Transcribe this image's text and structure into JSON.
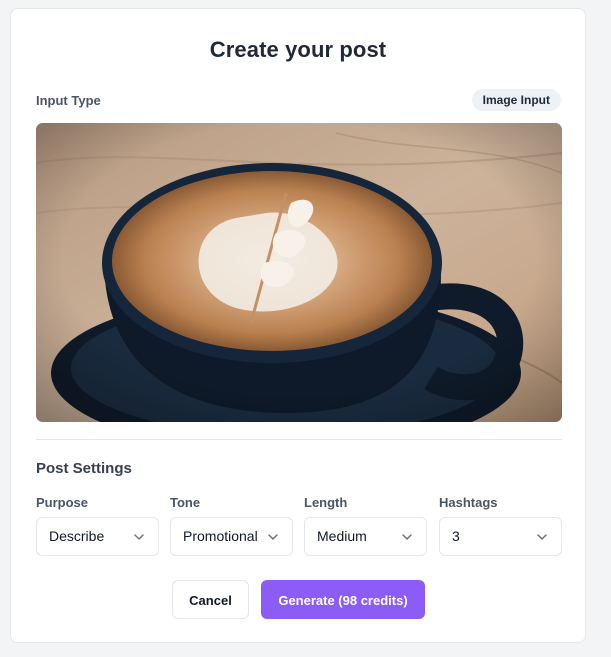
{
  "form": {
    "title": "Create your post",
    "input_type_label": "Input Type",
    "input_type_badge": "Image Input",
    "image_description": "coffee-cup-latte-art-photo",
    "settings_title": "Post Settings",
    "fields": {
      "purpose": {
        "label": "Purpose",
        "value": "Describe"
      },
      "tone": {
        "label": "Tone",
        "value": "Promotional"
      },
      "length": {
        "label": "Length",
        "value": "Medium"
      },
      "hashtags": {
        "label": "Hashtags",
        "value": "3"
      }
    },
    "buttons": {
      "cancel": "Cancel",
      "generate": "Generate (98 credits)"
    }
  },
  "colors": {
    "accent": "#8b5cf6",
    "background": "#f3f4f6",
    "card": "#ffffff",
    "border": "#e5e7eb"
  },
  "icons": {
    "select_chevron": "chevron-down-icon"
  }
}
